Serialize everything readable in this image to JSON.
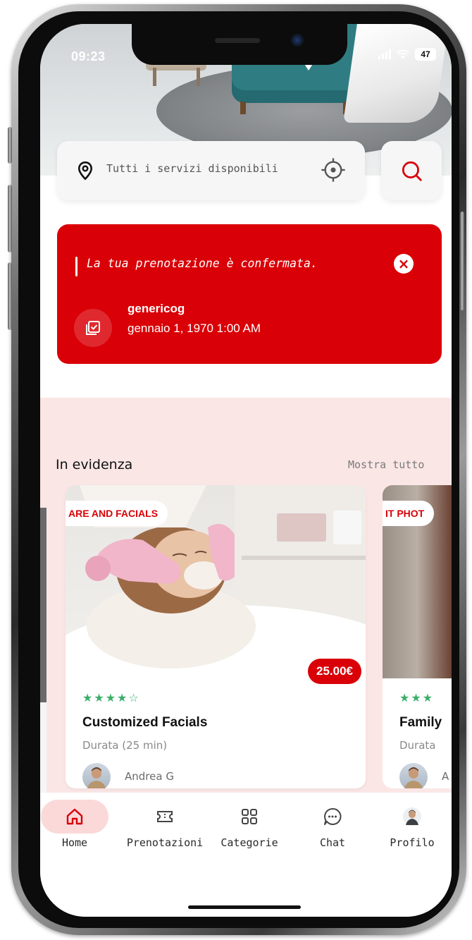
{
  "status_bar": {
    "time": "09:23",
    "battery": "47"
  },
  "search": {
    "placeholder": "Tutti i servizi disponibili"
  },
  "alert": {
    "message": "La tua prenotazione è confermata.",
    "name": "genericog",
    "datetime": "gennaio 1, 1970 1:00 AM"
  },
  "featured": {
    "title": "In evidenza",
    "show_all": "Mostra tutto",
    "cards": [
      {
        "category": "ARE AND FACIALS",
        "price": "25.00€",
        "stars": "★★★★☆",
        "title": "Customized Facials",
        "duration": "Durata (25 min)",
        "author": "Andrea G"
      },
      {
        "category": "IT PHOT",
        "stars": "★★★",
        "title": "Family",
        "duration": "Durata",
        "author": "A"
      }
    ]
  },
  "nav": {
    "items": [
      {
        "label": "Home",
        "icon": "home-icon",
        "active": true
      },
      {
        "label": "Prenotazioni",
        "icon": "ticket-icon",
        "active": false
      },
      {
        "label": "Categorie",
        "icon": "grid-icon",
        "active": false
      },
      {
        "label": "Chat",
        "icon": "chat-icon",
        "active": false
      },
      {
        "label": "Profilo",
        "icon": "avatar",
        "active": false
      }
    ]
  },
  "colors": {
    "accent": "#d90007",
    "featured_bg": "#fbe6e6",
    "star": "#3cae6a",
    "nav_active": "#fbd9d9"
  }
}
